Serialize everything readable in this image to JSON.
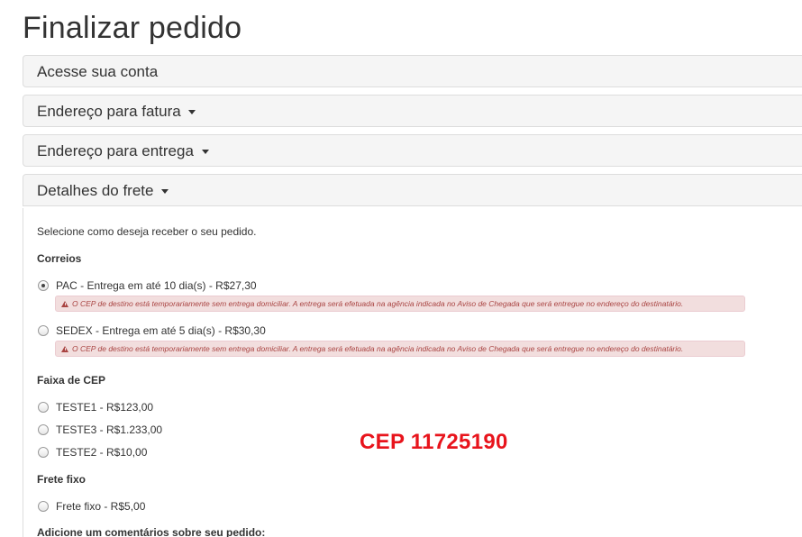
{
  "page_title": "Finalizar pedido",
  "sections": {
    "login": "Acesse sua conta",
    "billing": "Endereço para fatura",
    "delivery": "Endereço para entrega",
    "shipping": "Detalhes do frete"
  },
  "shipping": {
    "intro": "Selecione como deseja receber o seu pedido.",
    "groups": {
      "correios": {
        "title": "Correios",
        "options": [
          {
            "label": "PAC - Entrega em até 10 dia(s) - R$27,30",
            "checked": true,
            "warning": "O CEP de destino está temporariamente sem entrega domiciliar. A entrega será efetuada na agência indicada no Aviso de Chegada que será entregue no endereço do destinatário."
          },
          {
            "label": "SEDEX - Entrega em até 5 dia(s) - R$30,30",
            "checked": false,
            "warning": "O CEP de destino está temporariamente sem entrega domiciliar. A entrega será efetuada na agência indicada no Aviso de Chegada que será entregue no endereço do destinatário."
          }
        ]
      },
      "faixa": {
        "title": "Faixa de CEP",
        "options": [
          {
            "label": "TESTE1 - R$123,00",
            "checked": false
          },
          {
            "label": "TESTE3 - R$1.233,00",
            "checked": false
          },
          {
            "label": "TESTE2 - R$10,00",
            "checked": false
          }
        ]
      },
      "fixo": {
        "title": "Frete fixo",
        "options": [
          {
            "label": "Frete fixo - R$5,00",
            "checked": false
          }
        ]
      }
    },
    "comment_title": "Adicione um comentários sobre seu pedido:"
  },
  "annotation": "CEP 11725190",
  "colors": {
    "annotation": "#e8141c",
    "alert_bg": "#f2dede",
    "alert_text": "#a94442",
    "panel_bg": "#f5f5f5"
  },
  "icons": {
    "caret": "caret-down-icon",
    "warning": "warning-triangle-icon",
    "radio": "radio-icon"
  }
}
